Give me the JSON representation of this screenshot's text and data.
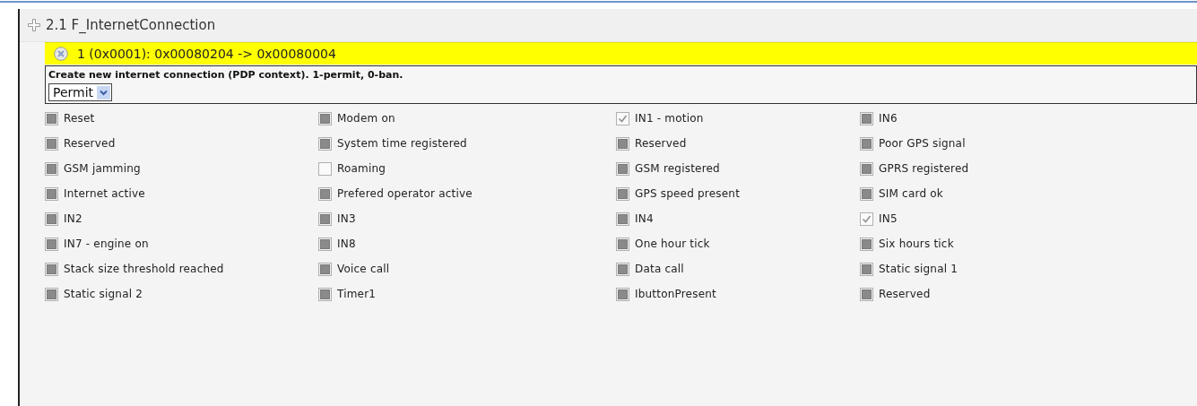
{
  "section": {
    "title": "2.1 F_InternetConnection"
  },
  "event": {
    "title": "1 (0x0001): 0x00080204 -> 0x00080004",
    "description": "Create new internet connection (PDP context). 1-permit, 0-ban.",
    "select": {
      "value": "Permit"
    },
    "flags": [
      {
        "label": "Reset",
        "checked": false,
        "greyed": true
      },
      {
        "label": "Modem on",
        "checked": false,
        "greyed": true
      },
      {
        "label": "IN1 - motion",
        "checked": true,
        "greyed": false
      },
      {
        "label": "IN6",
        "checked": false,
        "greyed": true
      },
      {
        "label": "Reserved",
        "checked": false,
        "greyed": true
      },
      {
        "label": "System time registered",
        "checked": false,
        "greyed": true
      },
      {
        "label": "Reserved",
        "checked": false,
        "greyed": true
      },
      {
        "label": "Poor GPS signal",
        "checked": false,
        "greyed": true
      },
      {
        "label": "GSM jamming",
        "checked": false,
        "greyed": true
      },
      {
        "label": "Roaming",
        "checked": false,
        "greyed": false
      },
      {
        "label": "GSM registered",
        "checked": false,
        "greyed": true
      },
      {
        "label": "GPRS registered",
        "checked": false,
        "greyed": true
      },
      {
        "label": "Internet active",
        "checked": false,
        "greyed": true
      },
      {
        "label": "Prefered operator active",
        "checked": false,
        "greyed": true
      },
      {
        "label": "GPS speed present",
        "checked": false,
        "greyed": true
      },
      {
        "label": "SIM card ok",
        "checked": false,
        "greyed": true
      },
      {
        "label": "IN2",
        "checked": false,
        "greyed": true
      },
      {
        "label": "IN3",
        "checked": false,
        "greyed": true
      },
      {
        "label": "IN4",
        "checked": false,
        "greyed": true
      },
      {
        "label": "IN5",
        "checked": true,
        "greyed": false
      },
      {
        "label": "IN7 - engine on",
        "checked": false,
        "greyed": true
      },
      {
        "label": "IN8",
        "checked": false,
        "greyed": true
      },
      {
        "label": "One hour tick",
        "checked": false,
        "greyed": true
      },
      {
        "label": "Six hours tick",
        "checked": false,
        "greyed": true
      },
      {
        "label": "Stack size threshold reached",
        "checked": false,
        "greyed": true
      },
      {
        "label": "Voice call",
        "checked": false,
        "greyed": true
      },
      {
        "label": "Data call",
        "checked": false,
        "greyed": true
      },
      {
        "label": "Static signal 1",
        "checked": false,
        "greyed": true
      },
      {
        "label": "Static signal 2",
        "checked": false,
        "greyed": true
      },
      {
        "label": "Timer1",
        "checked": false,
        "greyed": true
      },
      {
        "label": "IbuttonPresent",
        "checked": false,
        "greyed": true
      },
      {
        "label": "Reserved",
        "checked": false,
        "greyed": true
      }
    ]
  }
}
